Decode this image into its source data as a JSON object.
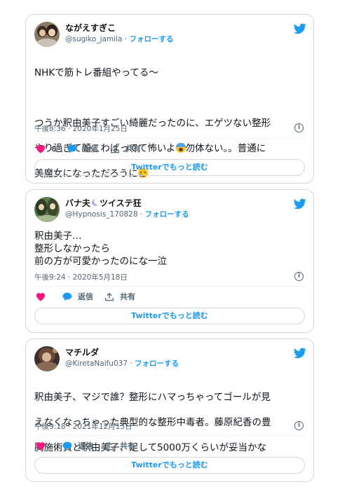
{
  "common": {
    "reply_label": "返信",
    "share_label": "共有",
    "read_more_label": "Twitterでもっと読む",
    "follow_label": "フォローする",
    "separator": "·"
  },
  "colors": {
    "twitter_blue": "#1d9bf0",
    "like_red": "#f91880"
  },
  "tweets": [
    {
      "name": "ながえすぎこ",
      "handle": "@sugiko_jamila",
      "text": "NHKで筋トレ番組やってる〜\n\nつうか釈由美子すごい綺麗だったのに、エゲツない整形やり過ぎて顔こわばってて怖いよ😱勿体ない。。普通に美魔女になっただろうに😢",
      "text_line1": "NHKで筋トレ番組やってる〜",
      "text_line2": "つうか釈由美子すごい綺麗だったのに、エゲツない整形",
      "text_line3a": "やり過ぎて顔こわばってて怖いよ",
      "text_line3b": "勿体ない。。普通に",
      "text_line4": "美魔女になっただろうに",
      "timestamp": "午後8:36 · 2020年1月25日",
      "like_count": "6"
    },
    {
      "name": "バナ夫",
      "name_suffix": "ツイステ狂",
      "handle": "@Hypnosis_170828",
      "text": "釈由美子…\n整形しなかったら\n前の方が可愛かったのにな一泣",
      "timestamp": "午後9:24 · 2020年5月18日"
    },
    {
      "name": "マチルダ",
      "handle": "@KiretaNaifu037",
      "text": "釈由美子、マジで誰？整形にハマっちゃってゴールが見えなくなっちゃった典型的な整形中毒者。藤原紀香の豊胸施術費と釈由美子、足して5000万くらいが妥当かな",
      "text_line1": "釈由美子、マジで誰？整形にハマっちゃってゴールが見",
      "text_line2": "えなくなっちゃった典型的な整形中毒者。藤原紀香の豊",
      "text_line3": "胸施術費と釈由美子、足して5000万くらいが妥当かな",
      "timestamp": "午後9:18 · 2021年12月13日"
    }
  ]
}
